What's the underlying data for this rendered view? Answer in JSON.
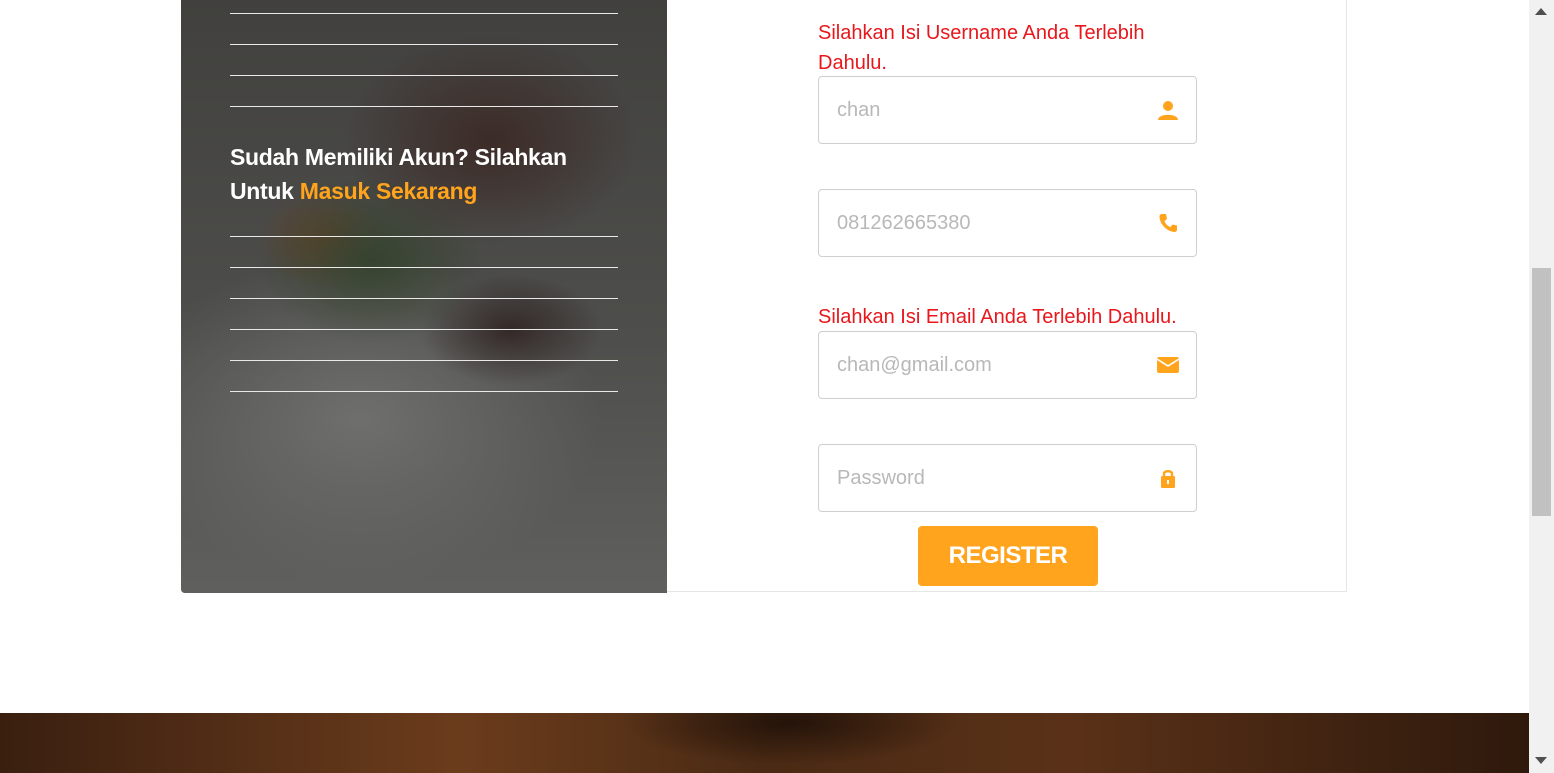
{
  "sidebar": {
    "login_prompt": "Sudah Memiliki Akun? Silahkan Untuk",
    "login_link": "Masuk Sekarang"
  },
  "form": {
    "username_error": "Silahkan Isi Username Anda Terlebih Dahulu.",
    "username_placeholder": "chan",
    "phone_placeholder": "081262665380",
    "email_error": "Silahkan Isi Email Anda Terlebih Dahulu.",
    "email_placeholder": "chan@gmail.com",
    "password_placeholder": "Password",
    "register_label": "REGISTER"
  },
  "colors": {
    "accent": "#ffa41c",
    "error": "#e8171c"
  },
  "icons": {
    "username": "user-icon",
    "phone": "phone-icon",
    "email": "envelope-icon",
    "password": "lock-icon"
  }
}
